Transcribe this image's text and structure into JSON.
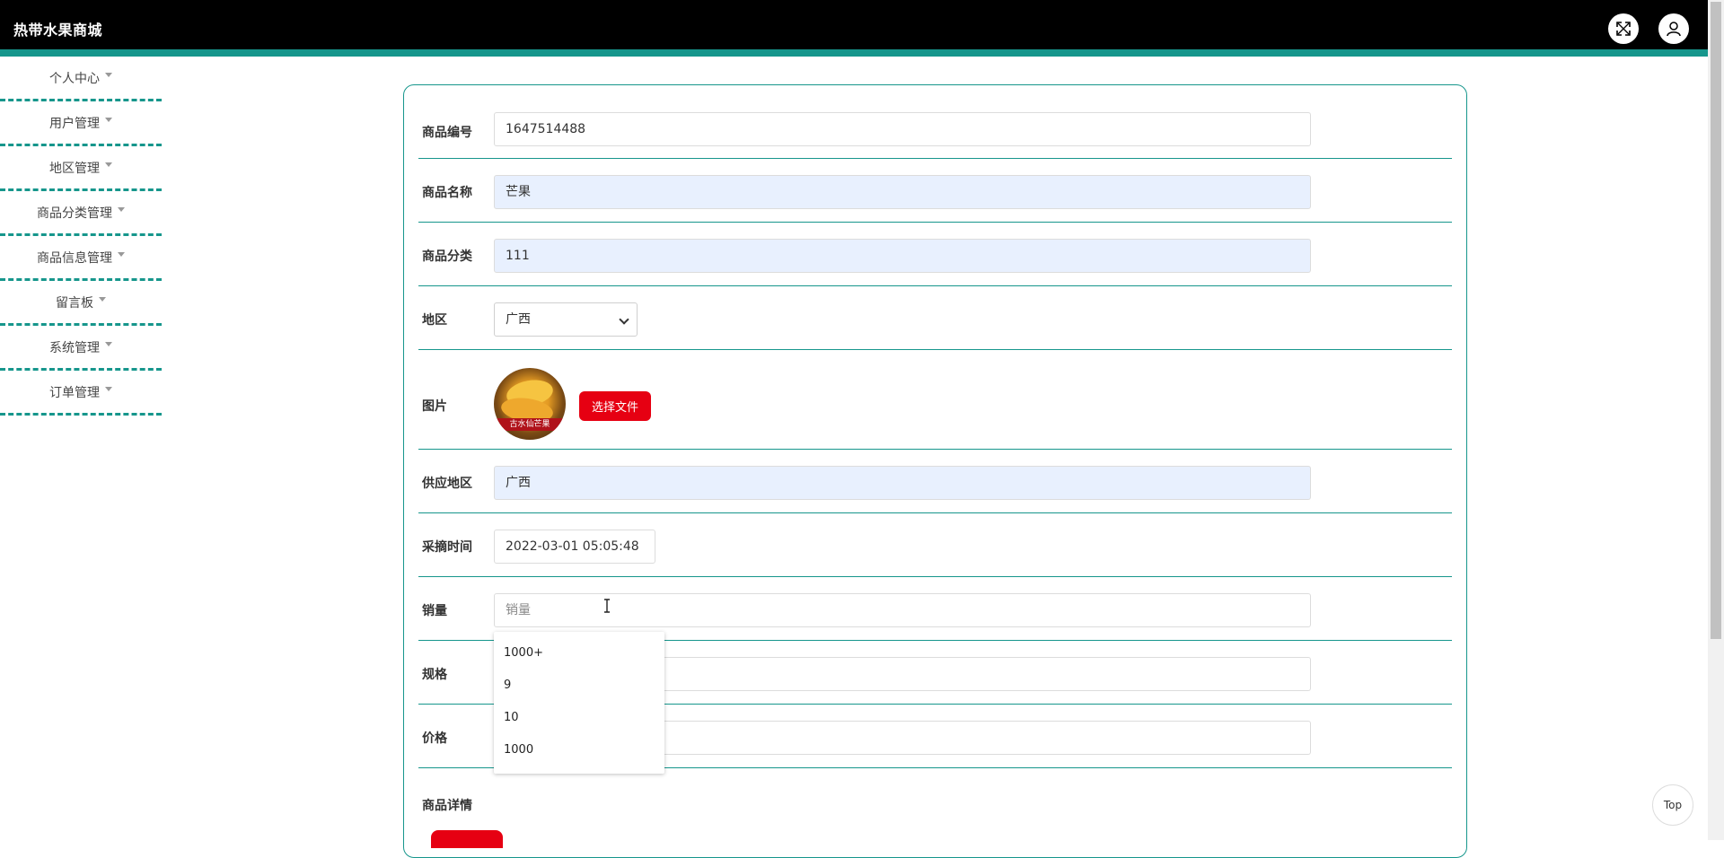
{
  "header": {
    "app_title": "热带水果商城",
    "fullscreen_icon": "fullscreen-icon",
    "user_icon": "user-icon",
    "colors": {
      "bar": "#000000",
      "accent": "#16968c"
    }
  },
  "sidebar": {
    "items": [
      {
        "label": "个人中心"
      },
      {
        "label": "用户管理"
      },
      {
        "label": "地区管理"
      },
      {
        "label": "商品分类管理"
      },
      {
        "label": "商品信息管理"
      },
      {
        "label": "留言板"
      },
      {
        "label": "系统管理"
      },
      {
        "label": "订单管理"
      }
    ]
  },
  "form": {
    "code": {
      "label": "商品编号",
      "value": "1647514488"
    },
    "name": {
      "label": "商品名称",
      "value": "芒果"
    },
    "category": {
      "label": "商品分类",
      "value": "111"
    },
    "region": {
      "label": "地区",
      "selected": "广西"
    },
    "image": {
      "label": "图片",
      "upload_button": "选择文件",
      "image_caption": "古水仙芒果"
    },
    "supply_region": {
      "label": "供应地区",
      "value": "广西"
    },
    "pick_time": {
      "label": "采摘时间",
      "value": "2022-03-01 05:05:48"
    },
    "sales": {
      "label": "销量",
      "placeholder": "销量"
    },
    "spec": {
      "label": "规格"
    },
    "price": {
      "label": "价格"
    },
    "detail": {
      "label": "商品详情"
    }
  },
  "sales_suggestions": [
    "1000+",
    "9",
    "10",
    "1000"
  ],
  "back_to_top": "Top"
}
